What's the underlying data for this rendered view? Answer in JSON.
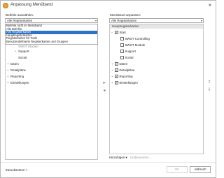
{
  "window": {
    "title": "Anpassung Menüband",
    "close_glyph": "×"
  },
  "left_panel": {
    "label": "Befehle auswählen:",
    "selected": "Alle Registerkarten",
    "dropdown_items": [
      "Befehle nicht im Menüband",
      "Alle Befehle",
      "Alle Registerkarten",
      "Hauptregisterkarten",
      "Registerkarten für Tools",
      "Benutzerdefinierte Registerkarten und Gruppen"
    ],
    "dropdown_selected_index": 2,
    "tree_ghost_text": "SWOT Module",
    "tree_items": [
      {
        "label": "Support",
        "expander": "+"
      },
      {
        "label": "Social",
        "expander": ""
      },
      {
        "label": "Daten",
        "expander": "+"
      },
      {
        "label": "Detailpläne",
        "expander": "+"
      },
      {
        "label": "Reporting",
        "expander": "+"
      },
      {
        "label": "Einstellungen",
        "expander": "+"
      }
    ]
  },
  "right_panel": {
    "label": "Menüband anpassen:",
    "selected": "Alle Registerkarten",
    "header": "Hauptregisterkarten",
    "tree_items": [
      {
        "label": "Start",
        "checked": true,
        "expander": "−"
      },
      {
        "label": "SWOT Controlling",
        "checked": false,
        "expander": ""
      },
      {
        "label": "SWOT Module",
        "checked": false,
        "expander": ""
      },
      {
        "label": "Support",
        "checked": false,
        "expander": ""
      },
      {
        "label": "Social",
        "checked": false,
        "expander": ""
      },
      {
        "label": "Daten",
        "checked": true,
        "expander": "+"
      },
      {
        "label": "Detailpläne",
        "checked": true,
        "expander": "+"
      },
      {
        "label": "Reporting",
        "checked": true,
        "expander": "+"
      },
      {
        "label": "Einstellungen",
        "checked": true,
        "expander": "+"
      }
    ],
    "add_label": "Hinzufügen ▾",
    "rename_label": "Umbenennen..."
  },
  "icons": {
    "add_arrow": "▸",
    "remove_arrow": "◂",
    "up_arrow": "⇧",
    "down_arrow": "⇩",
    "combo_arrow": "▾"
  },
  "footer": {
    "reset_label": "Zurücksetzen ˅",
    "ok_label": "OK",
    "cancel_label": "Abbruch"
  }
}
